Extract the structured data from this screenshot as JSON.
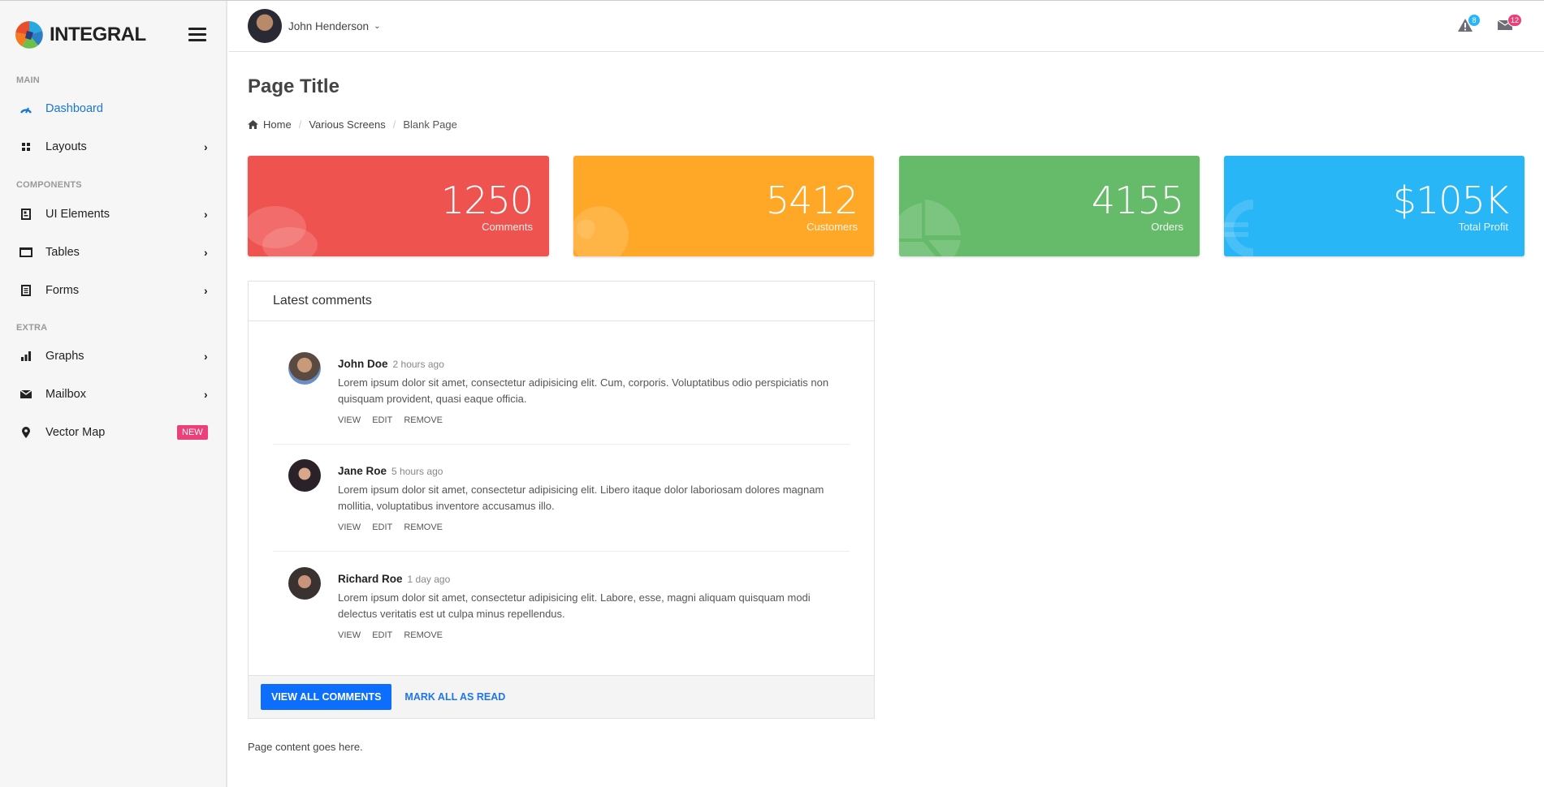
{
  "brand": {
    "name": "INTEGRAL"
  },
  "sidebar": {
    "sections": [
      {
        "label": "MAIN"
      },
      {
        "label": "COMPONENTS"
      },
      {
        "label": "EXTRA"
      }
    ],
    "items": [
      {
        "label": "Dashboard",
        "icon": "dashboard-gauge-icon",
        "active": true,
        "has_submenu": false
      },
      {
        "label": "Layouts",
        "icon": "grid-icon",
        "active": false,
        "has_submenu": true
      },
      {
        "label": "UI Elements",
        "icon": "document-icon",
        "active": false,
        "has_submenu": true
      },
      {
        "label": "Tables",
        "icon": "table-window-icon",
        "active": false,
        "has_submenu": true
      },
      {
        "label": "Forms",
        "icon": "form-list-icon",
        "active": false,
        "has_submenu": true
      },
      {
        "label": "Graphs",
        "icon": "bar-chart-icon",
        "active": false,
        "has_submenu": true
      },
      {
        "label": "Mailbox",
        "icon": "envelope-icon",
        "active": false,
        "has_submenu": true
      },
      {
        "label": "Vector Map",
        "icon": "map-pin-icon",
        "active": false,
        "has_submenu": false,
        "badge": "NEW"
      }
    ],
    "chevron": "›"
  },
  "topbar": {
    "user_name": "John Henderson",
    "caret": "⌄",
    "notifications": {
      "icon": "warning-icon",
      "count": "8",
      "badge_color": "#29b6f6"
    },
    "messages": {
      "icon": "envelope-icon",
      "count": "12",
      "badge_color": "#ec407a"
    }
  },
  "page": {
    "title": "Page Title",
    "breadcrumb": [
      "Home",
      "Various Screens",
      "Blank Page"
    ],
    "breadcrumb_sep": "/",
    "content_text": "Page content goes here."
  },
  "stats": [
    {
      "value": "1250",
      "label": "Comments",
      "color": "#ef5350",
      "icon": "comments-icon"
    },
    {
      "value": "5412",
      "label": "Customers",
      "color": "#ffa726",
      "icon": "globe-icon"
    },
    {
      "value": "4155",
      "label": "Orders",
      "color": "#66bb6a",
      "icon": "pie-chart-icon"
    },
    {
      "value": "$105K",
      "label": "Total Profit",
      "color": "#29b6f6",
      "icon": "euro-icon"
    }
  ],
  "comments_card": {
    "title": "Latest comments",
    "comments": [
      {
        "name": "John Doe",
        "time": "2 hours ago",
        "text": "Lorem ipsum dolor sit amet, consectetur adipisicing elit. Cum, corporis. Voluptatibus odio perspiciatis non quisquam provident, quasi eaque officia.",
        "actions": [
          "VIEW",
          "EDIT",
          "REMOVE"
        ]
      },
      {
        "name": "Jane Roe",
        "time": "5 hours ago",
        "text": "Lorem ipsum dolor sit amet, consectetur adipisicing elit. Libero itaque dolor laboriosam dolores magnam mollitia, voluptatibus inventore accusamus illo.",
        "actions": [
          "VIEW",
          "EDIT",
          "REMOVE"
        ]
      },
      {
        "name": "Richard Roe",
        "time": "1 day ago",
        "text": "Lorem ipsum dolor sit amet, consectetur adipisicing elit. Labore, esse, magni aliquam quisquam modi delectus veritatis est ut culpa minus repellendus.",
        "actions": [
          "VIEW",
          "EDIT",
          "REMOVE"
        ]
      }
    ],
    "view_all_label": "VIEW ALL COMMENTS",
    "mark_read_label": "MARK ALL AS READ"
  },
  "colors": {
    "accent": "#1976d2",
    "primary_button": "#0d6efd",
    "new_badge": "#ec407a"
  }
}
